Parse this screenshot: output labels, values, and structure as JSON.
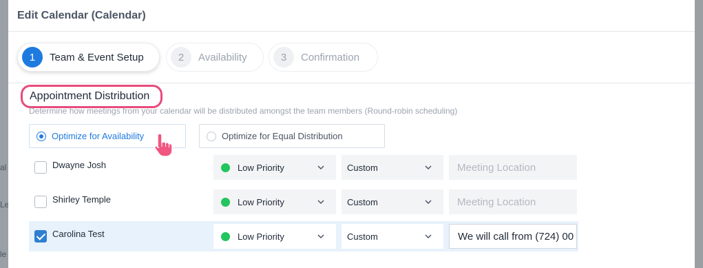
{
  "modal": {
    "title": "Edit Calendar (Calendar)"
  },
  "steps": [
    {
      "number": "1",
      "label": "Team & Event Setup",
      "active": true
    },
    {
      "number": "2",
      "label": "Availability",
      "active": false
    },
    {
      "number": "3",
      "label": "Confirmation",
      "active": false
    }
  ],
  "distribution": {
    "title": "Appointment Distribution",
    "description": "Determine how meetings from your calendar will be distributed amongst the team members (Round-robin scheduling)",
    "options": [
      {
        "label": "Optimize for Availability",
        "selected": true
      },
      {
        "label": "Optimize for Equal Distribution",
        "selected": false
      }
    ]
  },
  "members": [
    {
      "name": "Dwayne Josh",
      "checked": false,
      "priority": "Low Priority",
      "location_type": "Custom",
      "location_placeholder": "Meeting Location",
      "location_value": ""
    },
    {
      "name": "Shirley Temple",
      "checked": false,
      "priority": "Low Priority",
      "location_type": "Custom",
      "location_placeholder": "Meeting Location",
      "location_value": ""
    },
    {
      "name": "Carolina Test",
      "checked": true,
      "priority": "Low Priority",
      "location_type": "Custom",
      "location_placeholder": "Meeting Location",
      "location_value": "We will call from (724) 00"
    }
  ],
  "background_fragments": [
    "al",
    "Le",
    "le"
  ],
  "colors": {
    "accent": "#1f7ae0",
    "highlight_ring": "#e84a7b",
    "priority_low": "#22c55e",
    "checkbox_checked": "#2f7fd1"
  }
}
